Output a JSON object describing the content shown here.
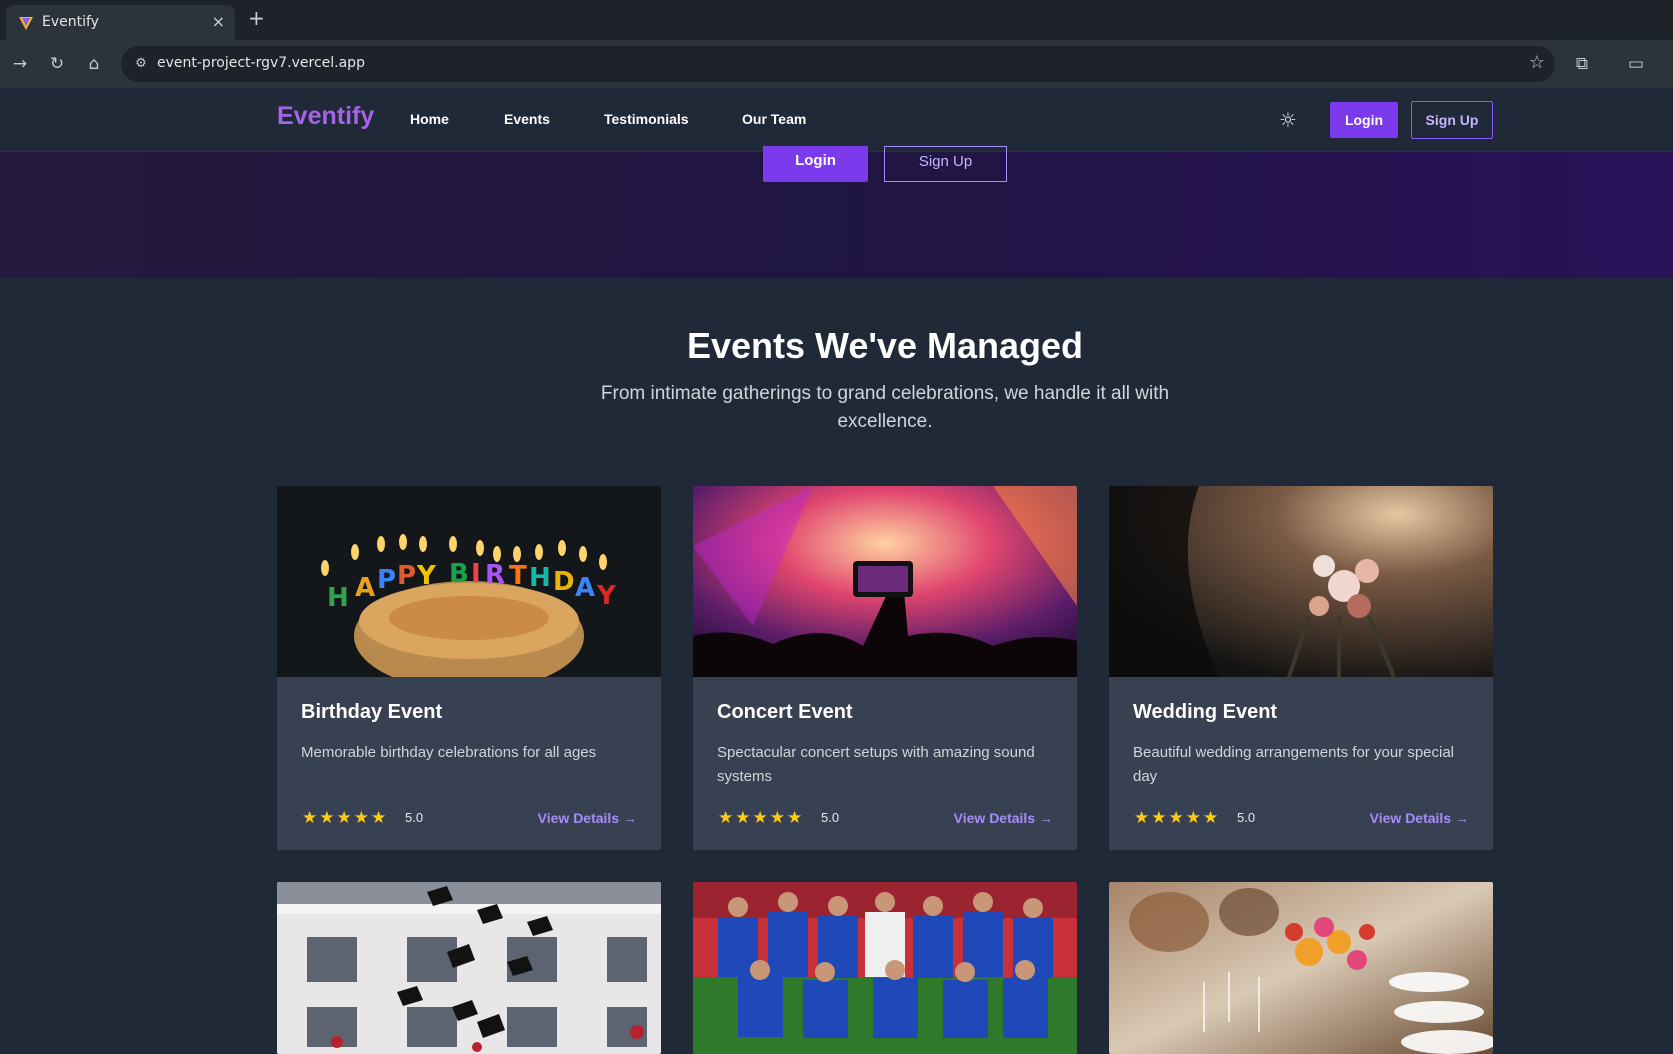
{
  "browser": {
    "tab_title": "Eventify",
    "tab_close": "×",
    "new_tab": "+",
    "url": "event-project-rgv7.vercel.app",
    "icons": [
      "forward-icon",
      "reload-icon",
      "home-icon",
      "site-settings-icon",
      "bookmark-star-icon",
      "extensions-icon",
      "cast-icon"
    ]
  },
  "nav": {
    "brand": "Eventify",
    "links": [
      "Home",
      "Events",
      "Testimonials",
      "Our Team"
    ],
    "login": "Login",
    "signup": "Sign Up"
  },
  "hero": {
    "login": "Login",
    "signup": "Sign Up"
  },
  "section": {
    "title": "Events We've Managed",
    "subtitle": "From intimate gatherings to grand celebrations, we handle it all with excellence."
  },
  "cards": [
    {
      "title": "Birthday Event",
      "desc": "Memorable birthday celebrations for all ages",
      "stars": "★★★★★",
      "rating": "5.0",
      "link": "View Details →"
    },
    {
      "title": "Concert Event",
      "desc": "Spectacular concert setups with amazing sound systems",
      "stars": "★★★★★",
      "rating": "5.0",
      "link": "View Details →"
    },
    {
      "title": "Wedding Event",
      "desc": "Beautiful wedding arrangements for your special day",
      "stars": "★★★★★",
      "rating": "5.0",
      "link": "View Details →"
    }
  ],
  "colors": {
    "accent": "#7c3aed",
    "brand": "#a564e6",
    "page_bg": "#1f2937",
    "card_bg": "#374151",
    "star": "#facc15"
  }
}
